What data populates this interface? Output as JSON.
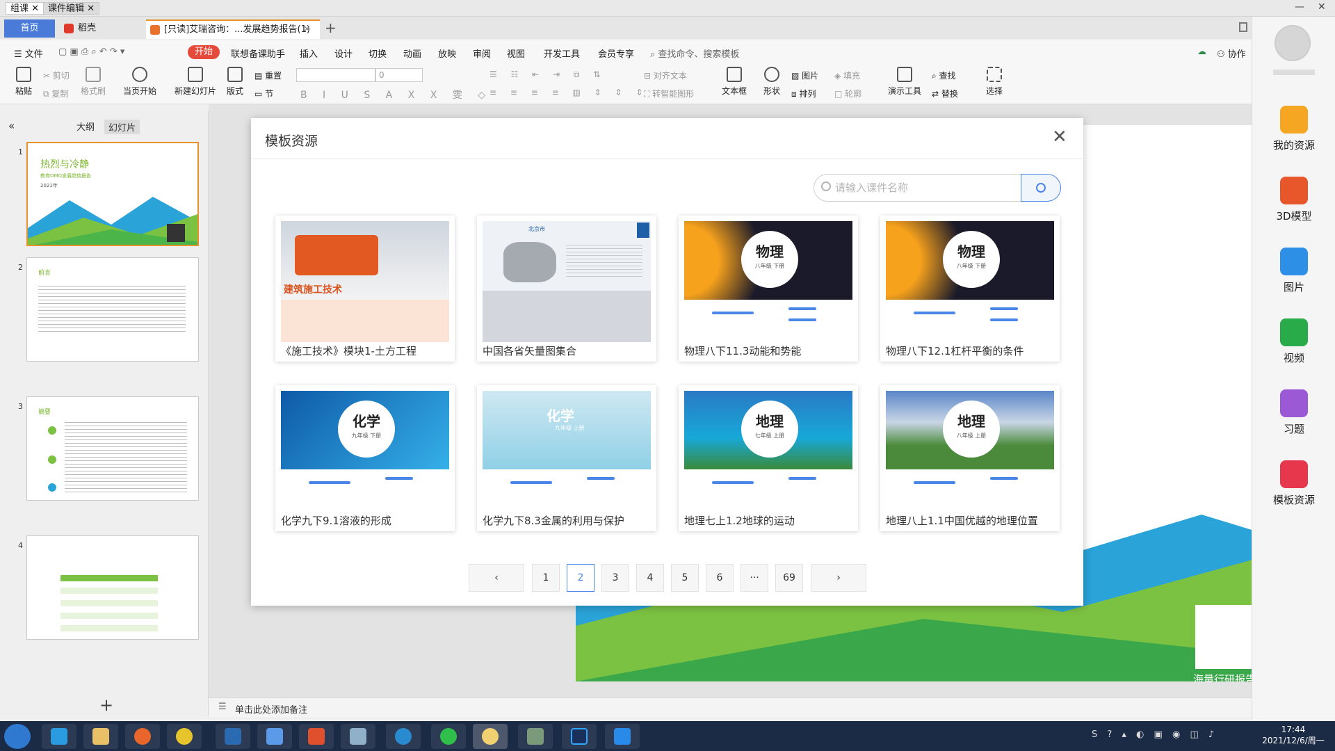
{
  "top_tabs": [
    "组课",
    "课件编辑"
  ],
  "tabbar": {
    "home": "首页",
    "tab1": "稻壳",
    "tab2": "[只读]艾瑞咨询：...发展趋势报告(1)"
  },
  "menu": {
    "file": "文件",
    "items": [
      "开始",
      "联想备课助手",
      "插入",
      "设计",
      "切换",
      "动画",
      "放映",
      "审阅",
      "视图",
      "开发工具",
      "会员专享"
    ],
    "search_hint": "查找命令、搜索模板",
    "collab": "协作"
  },
  "ribbon": {
    "paste": "粘贴",
    "cut": "剪切",
    "copy": "复制",
    "format_painter": "格式刷",
    "from_start": "当页开始",
    "new_slide": "新建幻灯片",
    "layout": "版式",
    "reset": "重置",
    "section": "节",
    "font_size": "0",
    "align_text": "对齐文本",
    "smart_art": "转智能图形",
    "textbox": "文本框",
    "shape": "形状",
    "picture": "图片",
    "arrange": "排列",
    "fill": "填充",
    "outline": "轮廓",
    "present_tools": "演示工具",
    "find": "查找",
    "replace": "替换",
    "select": "选择"
  },
  "left_panel": {
    "tab_outline": "大纲",
    "tab_slides": "幻灯片",
    "slide_numbers": [
      "1",
      "2",
      "3",
      "4"
    ],
    "slide1_title": "热烈与冷静",
    "slide1_sub": "教育OMO发展趋势报告",
    "slide1_year": "2021年",
    "slide2_title": "前言",
    "slide3_title": "摘要"
  },
  "notes_placeholder": "单击此处添加备注",
  "slide_footer_text": "海量行研报告免费读",
  "right_sidebar": {
    "items": [
      "我的资源",
      "3D模型",
      "图片",
      "视频",
      "习题",
      "模板资源"
    ]
  },
  "modal": {
    "title": "模板资源",
    "search_placeholder": "请输入课件名称",
    "cards": [
      {
        "caption": "《施工技术》模块1-土方工程",
        "heading": "建筑施工技术",
        "color": "#d9531e"
      },
      {
        "caption": "中国各省矢量图集合",
        "heading": "北京市",
        "color": "#1e5fa8"
      },
      {
        "caption": "物理八下11.3动能和势能",
        "heading": "物理",
        "sub": "八年级 下册",
        "color": "#1a1a2a"
      },
      {
        "caption": "物理八下12.1杠杆平衡的条件",
        "heading": "物理",
        "sub": "八年级 下册",
        "color": "#1a1a2a"
      },
      {
        "caption": "化学九下9.1溶液的形成",
        "heading": "化学",
        "sub": "九年级 下册",
        "color": "#1a8fd6"
      },
      {
        "caption": "化学九下8.3金属的利用与保护",
        "heading": "化学",
        "sub": "九年级 上册",
        "color": "#7fc6e0"
      },
      {
        "caption": "地理七上1.2地球的运动",
        "heading": "地理",
        "sub": "七年级 上册",
        "color": "#1877c6"
      },
      {
        "caption": "地理八上1.1中国优越的地理位置",
        "heading": "地理",
        "sub": "八年级 上册",
        "color": "#4a8a3a"
      }
    ],
    "pagination": [
      "1",
      "2",
      "3",
      "4",
      "5",
      "6",
      "···",
      "69"
    ],
    "current_page": "2"
  },
  "taskbar": {
    "time": "17:44",
    "date": "2021/12/6/周一"
  }
}
